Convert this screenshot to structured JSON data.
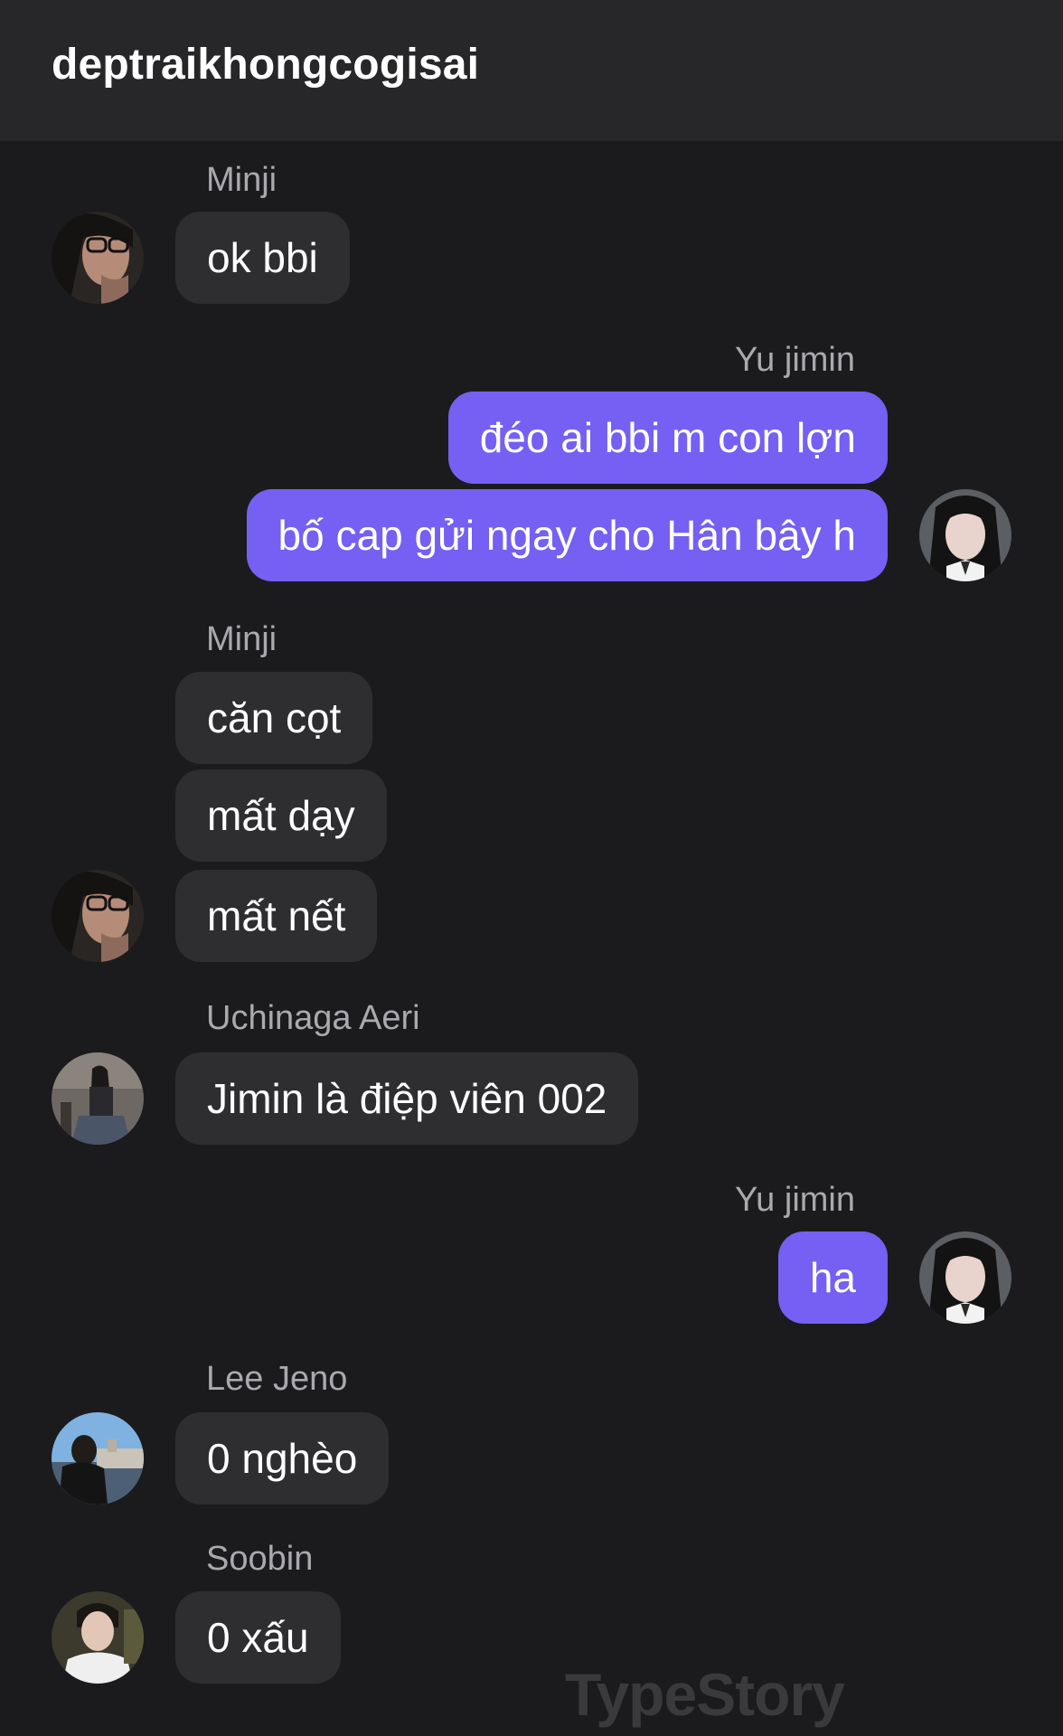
{
  "header": {
    "title": "deptraikhongcogisai"
  },
  "messages": [
    {
      "sender": "Minji",
      "texts": [
        "ok bbi"
      ],
      "avatar_icon": "minji-avatar-icon"
    },
    {
      "sender": "Yu jimin",
      "texts": [
        "đéo ai bbi m con lợn",
        "bố cap gửi ngay cho Hân bây h"
      ],
      "avatar_icon": "yu-jimin-avatar-icon"
    },
    {
      "sender": "Minji",
      "texts": [
        "căn cọt",
        "mất dạy",
        "mất nết"
      ],
      "avatar_icon": "minji-avatar-icon"
    },
    {
      "sender": "Uchinaga Aeri",
      "texts": [
        "Jimin là điệp viên 002"
      ],
      "avatar_icon": "uchinaga-aeri-avatar-icon"
    },
    {
      "sender": "Yu jimin",
      "texts": [
        "ha"
      ],
      "avatar_icon": "yu-jimin-avatar-icon"
    },
    {
      "sender": "Lee Jeno",
      "texts": [
        "0 nghèo"
      ],
      "avatar_icon": "lee-jeno-avatar-icon"
    },
    {
      "sender": "Soobin",
      "texts": [
        "0 xấu"
      ],
      "avatar_icon": "soobin-avatar-icon"
    }
  ],
  "watermark": {
    "text": "TypeStory"
  },
  "colors": {
    "background": "#1b1b1d",
    "header": "#272729",
    "incoming_bubble": "#2e2e31",
    "outgoing_bubble": "#7560f3",
    "sender_name": "#a9a9ae"
  }
}
